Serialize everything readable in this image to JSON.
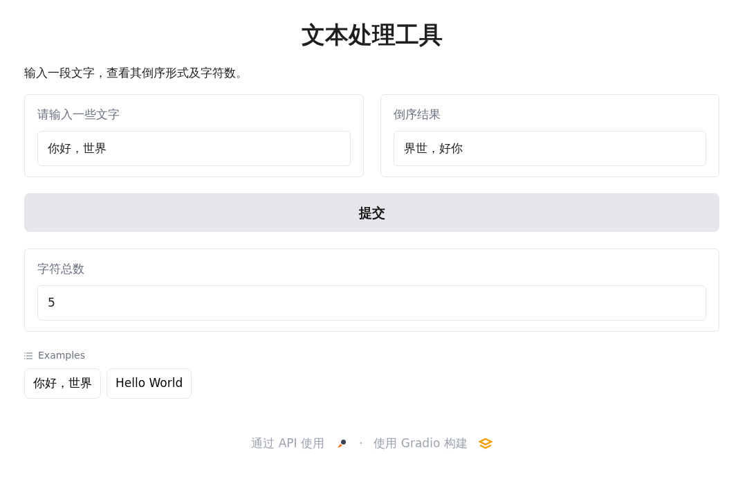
{
  "title": "文本处理工具",
  "description": "输入一段文字，查看其倒序形式及字符数。",
  "inputs": [
    {
      "label": "请输入一些文字",
      "value": "你好，世界"
    },
    {
      "label": "倒序结果",
      "value": "界世，好你"
    }
  ],
  "submit_button": "提交",
  "count_output": {
    "label": "字符总数",
    "value": "5"
  },
  "examples": {
    "label": "Examples",
    "items": [
      "你好，世界",
      "Hello World"
    ]
  },
  "footer": {
    "api_link": "通过 API 使用",
    "separator": "·",
    "built_with": "使用 Gradio 构建"
  }
}
